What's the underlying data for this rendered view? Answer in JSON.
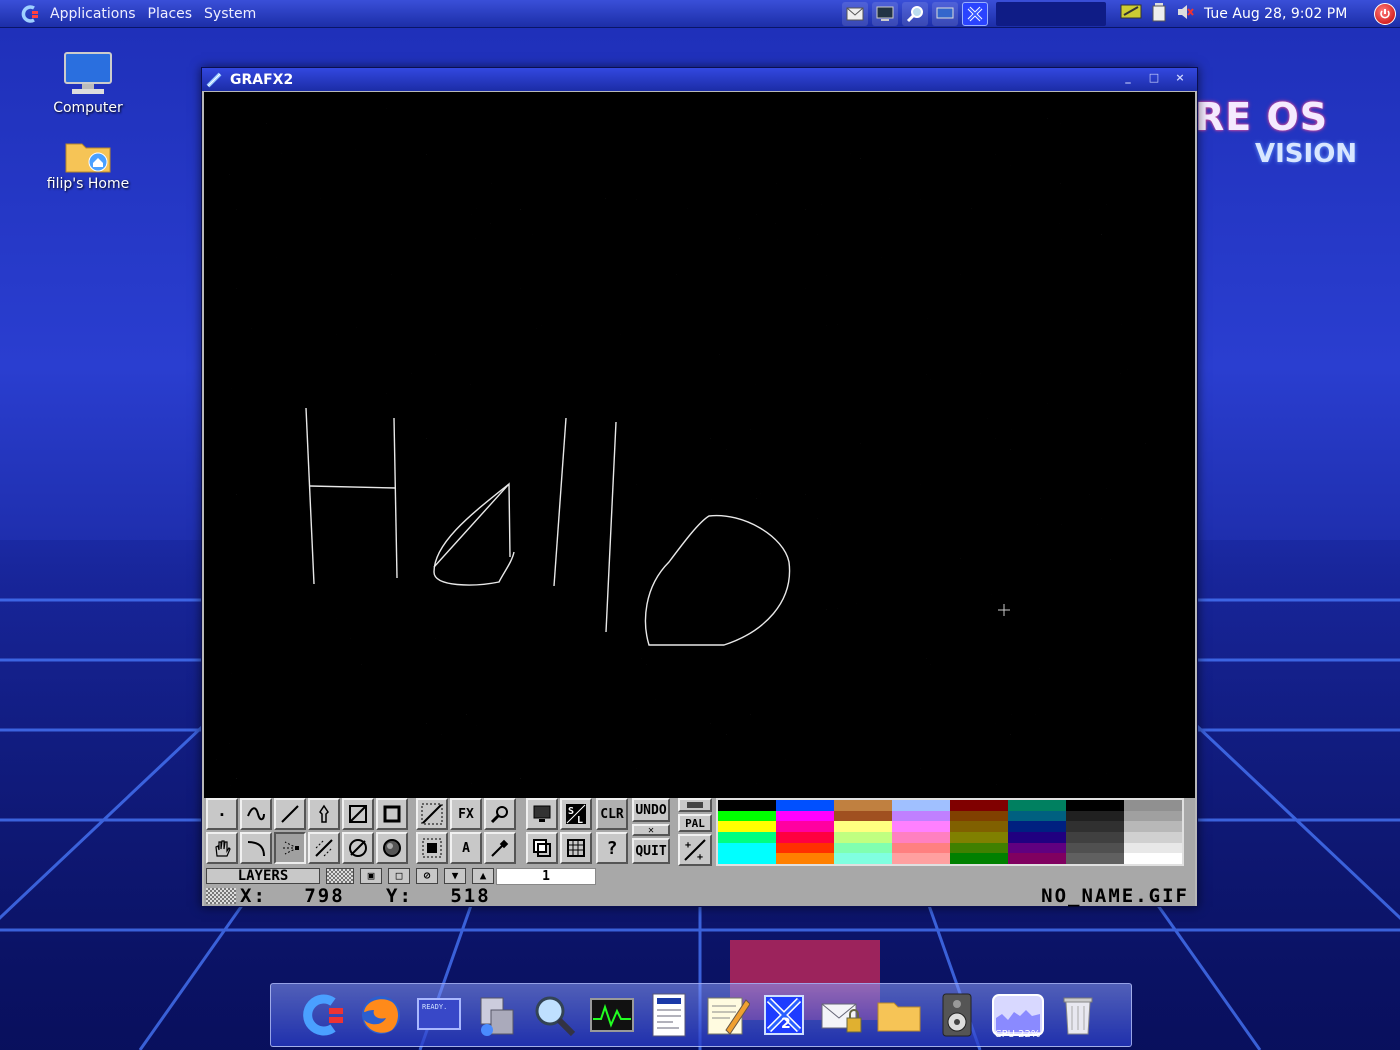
{
  "top_panel": {
    "menus": [
      "Applications",
      "Places",
      "System"
    ],
    "clock": "Tue Aug 28,  9:02 PM"
  },
  "desktop": {
    "icons": [
      {
        "label": "Computer"
      },
      {
        "label": "filip's Home"
      }
    ],
    "wallpaper_logo": {
      "line1": "RE OS",
      "line2": "VISION"
    }
  },
  "window": {
    "title": "GRAFX2",
    "canvas_text": "Hello"
  },
  "toolbar": {
    "tools_text": {
      "fx": "FX",
      "clr": "CLR",
      "undo": "UNDO",
      "quit": "QUIT",
      "pal": "PAL",
      "text": "A",
      "help": "?"
    },
    "layers_label": "LAYERS",
    "layer_value": "1",
    "coord_x_label": "X:",
    "coord_x": "798",
    "coord_y_label": "Y:",
    "coord_y": "518",
    "filename": "NO_NAME.GIF"
  },
  "palette": [
    [
      "#000000",
      "#00ff00",
      "#ffff00",
      "#00ff80",
      "#00ffff",
      "#00ffff"
    ],
    [
      "#0050ff",
      "#ff00ff",
      "#ff00a0",
      "#ff0040",
      "#ff3000",
      "#ff8000"
    ],
    [
      "#c08040",
      "#a05020",
      "#ffff80",
      "#c0ff80",
      "#80ffb0",
      "#80ffe0"
    ],
    [
      "#a0c0ff",
      "#c080ff",
      "#ff80ff",
      "#ff80c0",
      "#ff8080",
      "#ffa0a0"
    ],
    [
      "#800000",
      "#804000",
      "#806000",
      "#808000",
      "#408000",
      "#008000"
    ],
    [
      "#008060",
      "#006080",
      "#002080",
      "#200080",
      "#600080",
      "#800060"
    ],
    [
      "#000000",
      "#202020",
      "#303030",
      "#404040",
      "#505050",
      "#606060"
    ],
    [
      "#909090",
      "#a0a0a0",
      "#b8b8b8",
      "#d0d0d0",
      "#e8e8e8",
      "#ffffff"
    ]
  ],
  "dock": {
    "cpu_label": "CPU 22%"
  },
  "colors": {
    "panel": "#1c2ea8",
    "titlebar": "#1b2ca6",
    "canvas": "#000000",
    "toolbar": "#a8a8a8"
  }
}
